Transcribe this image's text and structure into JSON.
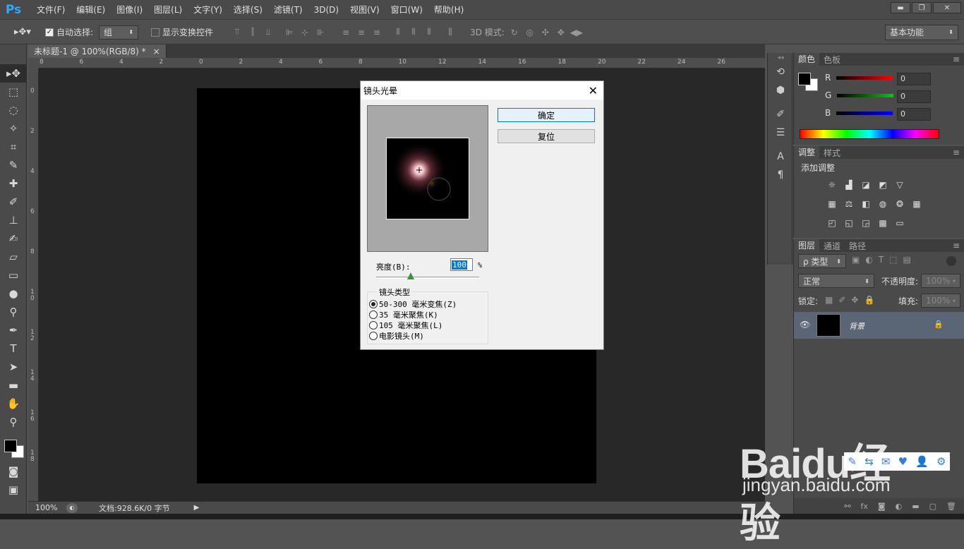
{
  "app": {
    "logo": "Ps"
  },
  "menu": [
    "文件(F)",
    "编辑(E)",
    "图像(I)",
    "图层(L)",
    "文字(Y)",
    "选择(S)",
    "滤镜(T)",
    "3D(D)",
    "视图(V)",
    "窗口(W)",
    "帮助(H)"
  ],
  "window_buttons": {
    "minimize": "▬",
    "restore": "❐",
    "close": "✕"
  },
  "options": {
    "auto_select_label": "自动选择:",
    "auto_select_value": "组",
    "show_transform_label": "显示变换控件",
    "mode_3d_label": "3D 模式:",
    "workspace": "基本功能"
  },
  "document": {
    "tab_title": "未标题-1 @ 100%(RGB/8) *",
    "tab_close": "×",
    "zoom": "100%",
    "doc_info": "文档:928.6K/0 字节"
  },
  "ruler_h": [
    "8",
    "6",
    "4",
    "2",
    "0",
    "2",
    "4",
    "6",
    "8",
    "10",
    "12",
    "14",
    "16",
    "18",
    "20",
    "22",
    "24",
    "26"
  ],
  "ruler_v": [
    "0",
    "2",
    "4",
    "6",
    "8",
    "10",
    "12",
    "14",
    "16",
    "18"
  ],
  "dialog": {
    "title": "镜头光晕",
    "ok": "确定",
    "reset": "复位",
    "brightness_label": "亮度(B):",
    "brightness_value": "100",
    "brightness_unit": "%",
    "brightness_level": 1.0,
    "lens_group_label": "镜头类型",
    "lens_options": [
      "50-300 毫米变焦(Z)",
      "35 毫米聚焦(K)",
      "105 毫米聚焦(L)",
      "电影镜头(M)"
    ],
    "selected_lens": 0
  },
  "color_panel": {
    "tabs": [
      "颜色",
      "色板"
    ],
    "channels": [
      {
        "name": "R",
        "value": "0"
      },
      {
        "name": "G",
        "value": "0"
      },
      {
        "name": "B",
        "value": "0"
      }
    ]
  },
  "adjustments_panel": {
    "tabs": [
      "调整",
      "样式"
    ],
    "heading": "添加调整"
  },
  "layers_panel": {
    "tabs": [
      "图层",
      "通道",
      "路径"
    ],
    "filter_kind": "ρ 类型",
    "blend_mode": "正常",
    "opacity_label": "不透明度:",
    "opacity_value": "100%",
    "lock_label": "锁定:",
    "fill_label": "填充:",
    "fill_value": "100%",
    "layer_name": "背景"
  },
  "watermark": {
    "brand": "Baidu经验",
    "url": "jingyan.baidu.com"
  },
  "colors": {
    "accent": "#0078d7",
    "ps_blue": "#31a8ff",
    "selected_layer": "#5a6676"
  }
}
